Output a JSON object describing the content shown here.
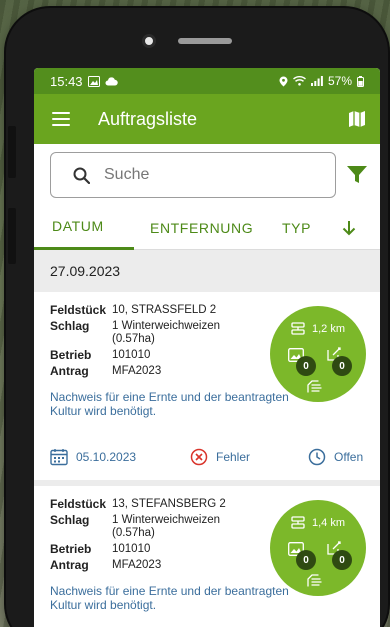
{
  "status_bar": {
    "time": "15:43",
    "battery": "57%"
  },
  "app_bar": {
    "title": "Auftragsliste",
    "menu_icon": "hamburger-icon",
    "map_icon": "map-icon"
  },
  "search": {
    "placeholder": "Suche",
    "value": ""
  },
  "tabs": [
    {
      "label": "DATUM",
      "active": true
    },
    {
      "label": "ENTFERNUNG",
      "active": false
    },
    {
      "label": "TYP",
      "active": false
    }
  ],
  "date_header": "27.09.2023",
  "labels": {
    "feldstueck": "Feldstück",
    "schlag": "Schlag",
    "betrieb": "Betrieb",
    "antrag": "Antrag"
  },
  "orders": [
    {
      "feldstueck": "10,  STRASSFELD 2",
      "schlag_line1": "1  Winterweichweizen",
      "schlag_line2": "(0.57ha)",
      "betrieb": "101010",
      "antrag": "MFA2023",
      "note": "Nachweis für eine Ernte und der beantragten Kultur wird benötigt.",
      "distance": "1,2 km",
      "photo_count": "0",
      "edit_count": "0",
      "due_date": "05.10.2023",
      "error_label": "Fehler",
      "status_label": "Offen"
    },
    {
      "feldstueck": "13,  STEFANSBERG 2",
      "schlag_line1": "1  Winterweichweizen",
      "schlag_line2": "(0.57ha)",
      "betrieb": "101010",
      "antrag": "MFA2023",
      "note": "Nachweis für eine Ernte und der beantragten Kultur wird benötigt.",
      "distance": "1,4 km",
      "photo_count": "0",
      "edit_count": "0"
    }
  ],
  "colors": {
    "primary": "#6aa51f",
    "status_bar": "#538e1d",
    "accent_text": "#4d8a18",
    "circle": "#7cb82a",
    "badge": "#2f4a12",
    "link": "#3b6e9c",
    "error": "#d9342b"
  }
}
